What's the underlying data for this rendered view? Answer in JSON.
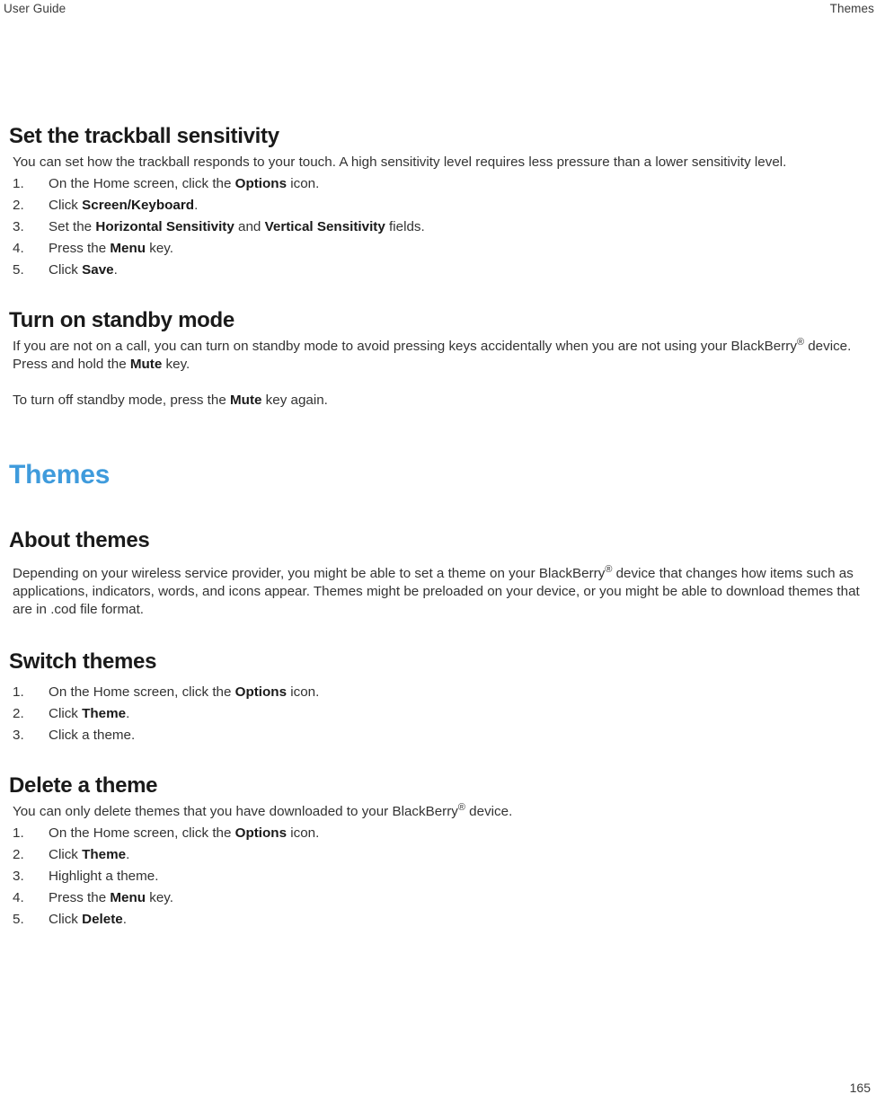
{
  "header": {
    "left": "User Guide",
    "right": "Themes"
  },
  "footer": {
    "page_number": "165"
  },
  "colors": {
    "section_title": "#3f9bdc",
    "body_text": "#333333",
    "heading_text": "#1a1a1a",
    "background": "#ffffff"
  },
  "topics": {
    "trackball": {
      "title": "Set the trackball sensitivity",
      "intro": "You can set how the trackball responds to your touch. A high sensitivity level requires less pressure than a lower sensitivity level.",
      "steps": [
        {
          "pre": "On the Home screen, click the ",
          "bold": "Options",
          "post": " icon."
        },
        {
          "pre": "Click ",
          "bold": "Screen/Keyboard",
          "post": "."
        },
        {
          "pre": "Set the ",
          "bold": "Horizontal Sensitivity",
          "mid": " and ",
          "bold2": "Vertical Sensitivity",
          "post": " fields."
        },
        {
          "pre": "Press the ",
          "bold": "Menu",
          "post": " key."
        },
        {
          "pre": "Click ",
          "bold": "Save",
          "post": "."
        }
      ]
    },
    "standby": {
      "title": "Turn on standby mode",
      "para1_pre": "If you are not on a call, you can turn on standby mode to avoid pressing keys accidentally when you are not using your BlackBerry",
      "para1_reg": "®",
      "para1_post": " device. Press and hold the ",
      "para1_bold": "Mute",
      "para1_end": " key.",
      "para2_pre": "To turn off standby mode, press the ",
      "para2_bold": "Mute",
      "para2_post": " key again."
    }
  },
  "section": {
    "title": "Themes",
    "about": {
      "title": "About themes",
      "body_pre": "Depending on your wireless service provider, you might be able to set a theme on your BlackBerry",
      "body_reg": "®",
      "body_post": " device that changes how items such as applications, indicators, words, and icons appear. Themes might be preloaded on your device, or you might be able to download themes that are in .cod file format."
    },
    "switch": {
      "title": "Switch themes",
      "steps": [
        {
          "pre": "On the Home screen, click the ",
          "bold": "Options",
          "post": " icon."
        },
        {
          "pre": "Click ",
          "bold": "Theme",
          "post": "."
        },
        {
          "pre": "Click a theme.",
          "bold": "",
          "post": ""
        }
      ]
    },
    "delete": {
      "title": "Delete a theme",
      "intro_pre": "You can only delete themes that you have downloaded to your BlackBerry",
      "intro_reg": "®",
      "intro_post": " device.",
      "steps": [
        {
          "pre": "On the Home screen, click the ",
          "bold": "Options",
          "post": " icon."
        },
        {
          "pre": "Click ",
          "bold": "Theme",
          "post": "."
        },
        {
          "pre": "Highlight a theme.",
          "bold": "",
          "post": ""
        },
        {
          "pre": "Press the ",
          "bold": "Menu",
          "post": " key."
        },
        {
          "pre": "Click ",
          "bold": "Delete",
          "post": "."
        }
      ]
    }
  }
}
